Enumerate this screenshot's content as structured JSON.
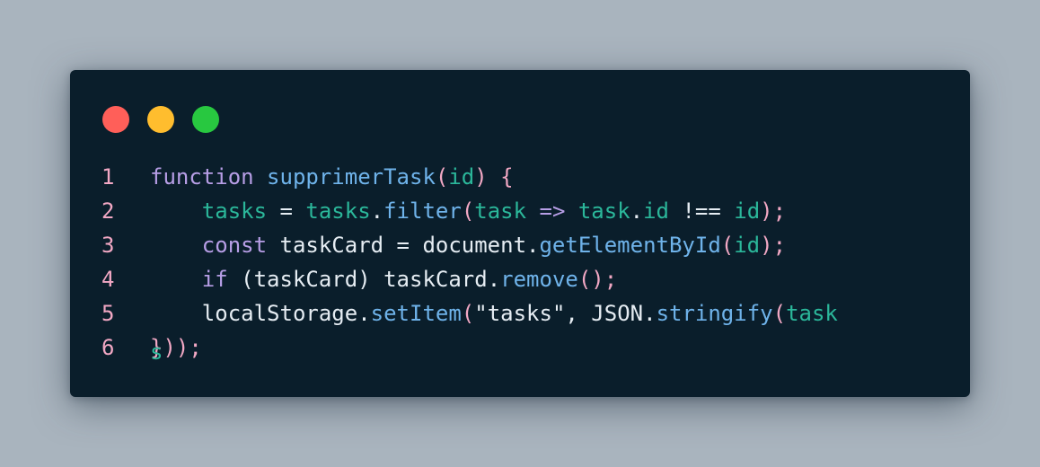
{
  "window": {
    "controls": [
      "close",
      "minimize",
      "maximize"
    ],
    "control_colors": {
      "close": "#ff5f59",
      "minimize": "#ffbd2e",
      "maximize": "#28c840"
    },
    "background": "#0a1e2b"
  },
  "code": {
    "language": "javascript",
    "lines": [
      {
        "number": "1",
        "tokens": [
          {
            "t": "function",
            "c": "kw"
          },
          {
            "t": " ",
            "c": "pl"
          },
          {
            "t": "supprimerTask",
            "c": "fn"
          },
          {
            "t": "(",
            "c": "pn"
          },
          {
            "t": "id",
            "c": "id"
          },
          {
            "t": ")",
            "c": "pn"
          },
          {
            "t": " ",
            "c": "pl"
          },
          {
            "t": "{",
            "c": "pn"
          }
        ]
      },
      {
        "number": "2",
        "tokens": [
          {
            "t": "    ",
            "c": "pl"
          },
          {
            "t": "tasks",
            "c": "id"
          },
          {
            "t": " = ",
            "c": "op"
          },
          {
            "t": "tasks",
            "c": "id"
          },
          {
            "t": ".",
            "c": "pl"
          },
          {
            "t": "filter",
            "c": "fn"
          },
          {
            "t": "(",
            "c": "pn"
          },
          {
            "t": "task",
            "c": "id"
          },
          {
            "t": " => ",
            "c": "kw"
          },
          {
            "t": "task",
            "c": "id"
          },
          {
            "t": ".",
            "c": "pl"
          },
          {
            "t": "id",
            "c": "id"
          },
          {
            "t": " !== ",
            "c": "op"
          },
          {
            "t": "id",
            "c": "id"
          },
          {
            "t": ");",
            "c": "pn"
          }
        ]
      },
      {
        "number": "3",
        "tokens": [
          {
            "t": "    ",
            "c": "pl"
          },
          {
            "t": "const",
            "c": "kw"
          },
          {
            "t": " taskCard = document",
            "c": "pl"
          },
          {
            "t": ".",
            "c": "pl"
          },
          {
            "t": "getElementById",
            "c": "fn"
          },
          {
            "t": "(",
            "c": "pn"
          },
          {
            "t": "id",
            "c": "id"
          },
          {
            "t": ");",
            "c": "pn"
          }
        ]
      },
      {
        "number": "4",
        "tokens": [
          {
            "t": "    ",
            "c": "pl"
          },
          {
            "t": "if",
            "c": "kw"
          },
          {
            "t": " (taskCard) taskCard",
            "c": "pl"
          },
          {
            "t": ".",
            "c": "pl"
          },
          {
            "t": "remove",
            "c": "fn"
          },
          {
            "t": "();",
            "c": "pn"
          }
        ]
      },
      {
        "number": "5",
        "tokens": [
          {
            "t": "    ",
            "c": "pl"
          },
          {
            "t": "localStorage",
            "c": "pl"
          },
          {
            "t": ".",
            "c": "pl"
          },
          {
            "t": "setItem",
            "c": "fn"
          },
          {
            "t": "(",
            "c": "pn"
          },
          {
            "t": "\"tasks\"",
            "c": "pl"
          },
          {
            "t": ", JSON",
            "c": "pl"
          },
          {
            "t": ".",
            "c": "pl"
          },
          {
            "t": "stringify",
            "c": "fn"
          },
          {
            "t": "(",
            "c": "pn"
          },
          {
            "t": "task",
            "c": "id"
          }
        ]
      },
      {
        "number": "6",
        "ghost": {
          "over": "}",
          "under": "s"
        },
        "tokens": [
          {
            "t": "));",
            "c": "pn"
          }
        ]
      }
    ]
  }
}
